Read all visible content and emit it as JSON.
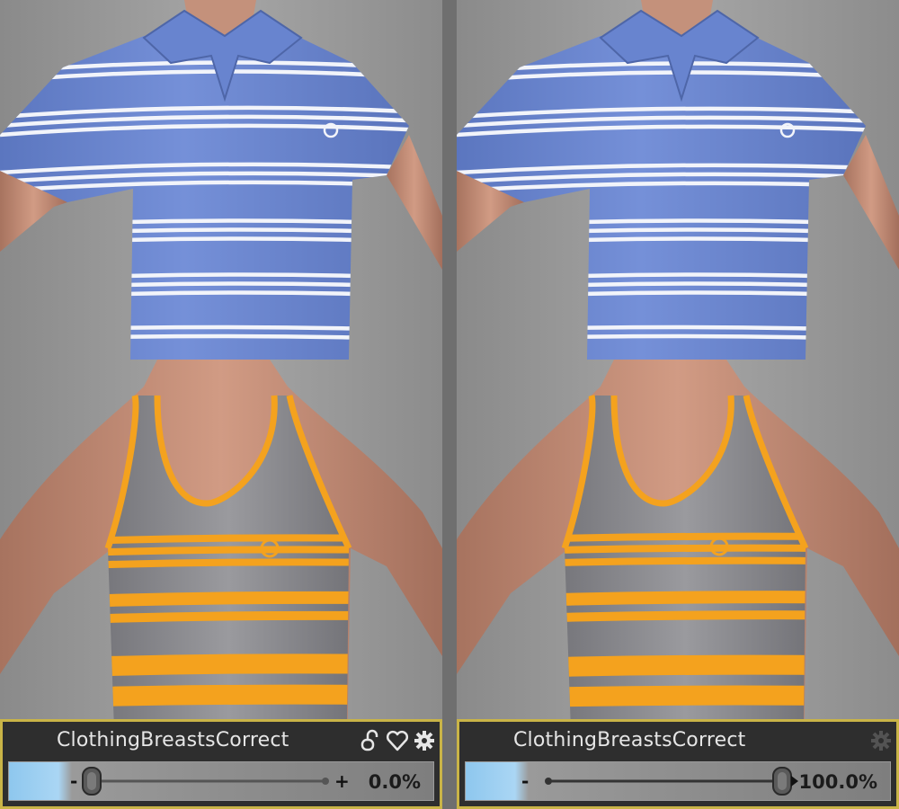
{
  "colors": {
    "background": "#6f6f6f",
    "widget_border": "#c9b447",
    "widget_bg": "#2e2e2e",
    "polo_blue": "#6d88d1",
    "polo_stripe": "#f2f4fa",
    "tank_gray": "#8b8b90",
    "tank_stripe": "#f4a21e",
    "skin": "#c58e78",
    "track_blue": "#9ccff0"
  },
  "renders": {
    "top_left": {
      "garment": "polo shirt",
      "stripe_color": "white"
    },
    "top_right": {
      "garment": "polo shirt",
      "stripe_color": "white"
    },
    "bottom_left": {
      "garment": "tank top",
      "stripe_color": "orange"
    },
    "bottom_right": {
      "garment": "tank top",
      "stripe_color": "orange"
    }
  },
  "sliders": {
    "left": {
      "label": "ClothingBreastsCorrect",
      "value": 0.0,
      "value_text": "0.0%",
      "icons": [
        "lock-icon",
        "favorite-heart-icon",
        "gear-icon"
      ]
    },
    "right": {
      "label": "ClothingBreastsCorrect",
      "value": 100.0,
      "value_text": "100.0%",
      "icons": [
        "gear-icon"
      ]
    }
  }
}
